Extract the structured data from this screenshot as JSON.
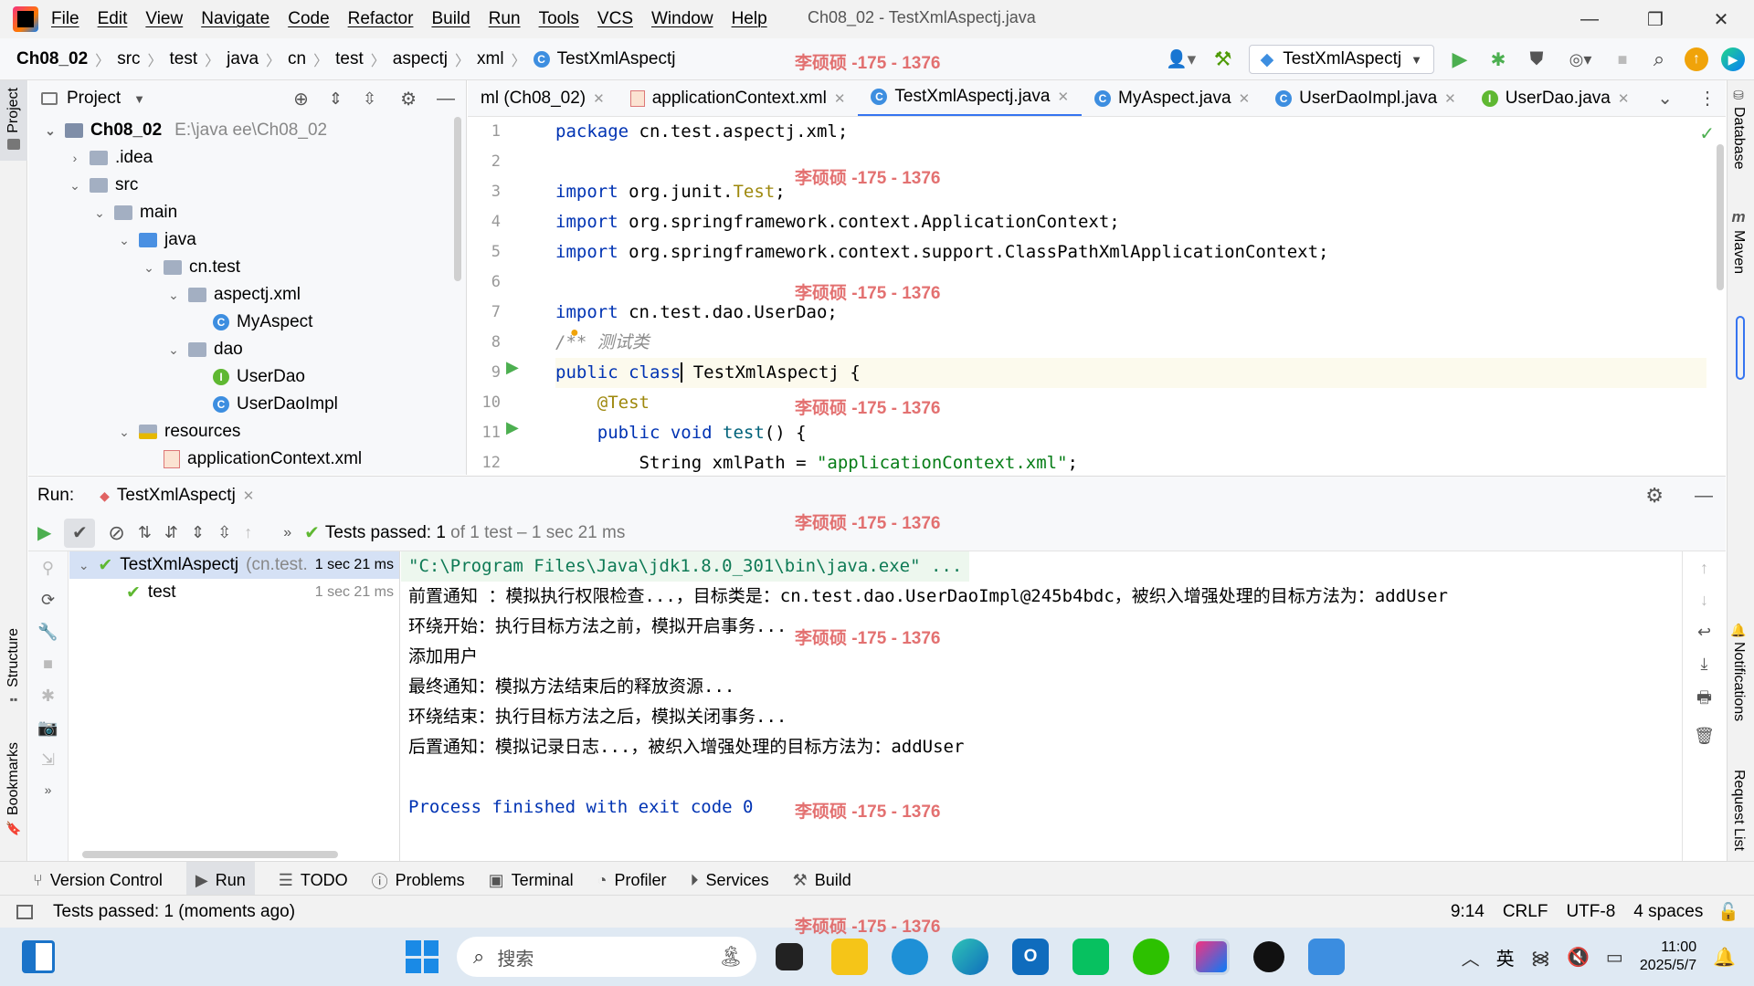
{
  "window": {
    "title": "Ch08_02 - TestXmlAspectj.java",
    "menu": [
      "File",
      "Edit",
      "View",
      "Navigate",
      "Code",
      "Refactor",
      "Build",
      "Run",
      "Tools",
      "VCS",
      "Window",
      "Help"
    ],
    "controls": [
      "—",
      "❐",
      "✕"
    ]
  },
  "breadcrumbs": [
    "Ch08_02",
    "src",
    "test",
    "java",
    "cn",
    "test",
    "aspectj",
    "xml",
    "TestXmlAspectj"
  ],
  "toolbar": {
    "run_config": "TestXmlAspectj"
  },
  "left_strip": [
    "Project",
    "Structure",
    "Bookmarks"
  ],
  "right_strip": [
    "Database",
    "Maven",
    "Notifications",
    "Request List"
  ],
  "project": {
    "header": "Project",
    "tree": [
      {
        "label": "Ch08_02",
        "hint": "E:\\java ee\\Ch08_02",
        "depth": 0,
        "kind": "module",
        "open": true
      },
      {
        "label": ".idea",
        "depth": 1,
        "kind": "folder",
        "open": false
      },
      {
        "label": "src",
        "depth": 1,
        "kind": "folder",
        "open": true
      },
      {
        "label": "main",
        "depth": 2,
        "kind": "folder",
        "open": true
      },
      {
        "label": "java",
        "depth": 3,
        "kind": "srcfolder",
        "open": true
      },
      {
        "label": "cn.test",
        "depth": 4,
        "kind": "package",
        "open": true
      },
      {
        "label": "aspectj.xml",
        "depth": 5,
        "kind": "package",
        "open": true
      },
      {
        "label": "MyAspect",
        "depth": 6,
        "kind": "class"
      },
      {
        "label": "dao",
        "depth": 5,
        "kind": "package",
        "open": true
      },
      {
        "label": "UserDao",
        "depth": 6,
        "kind": "interface"
      },
      {
        "label": "UserDaoImpl",
        "depth": 6,
        "kind": "class"
      },
      {
        "label": "resources",
        "depth": 3,
        "kind": "resfolder",
        "open": true
      },
      {
        "label": "applicationContext.xml",
        "depth": 4,
        "kind": "xml"
      }
    ]
  },
  "editor": {
    "tabs": [
      {
        "label": "ml (Ch08_02)",
        "kind": "xml",
        "active": false
      },
      {
        "label": "applicationContext.xml",
        "kind": "xml",
        "active": false
      },
      {
        "label": "TestXmlAspectj.java",
        "kind": "class",
        "active": true
      },
      {
        "label": "MyAspect.java",
        "kind": "class",
        "active": false
      },
      {
        "label": "UserDaoImpl.java",
        "kind": "class",
        "active": false
      },
      {
        "label": "UserDao.java",
        "kind": "interface",
        "active": false
      }
    ],
    "line_numbers": [
      "1",
      "2",
      "3",
      "4",
      "5",
      "6",
      "7",
      "8",
      "9",
      "10",
      "11",
      "12"
    ],
    "code": {
      "l1a": "package",
      "l1b": " cn.test.aspectj.xml;",
      "l3a": "import",
      "l3b": " org.junit.",
      "l3c": "Test",
      "l3d": ";",
      "l4a": "import",
      "l4b": " org.springframework.context.ApplicationContext;",
      "l5a": "import",
      "l5b": " org.springframework.context.support.ClassPathXmlApplicationContext;",
      "l7a": "import",
      "l7b": " cn.test.dao.UserDao;",
      "l8": "/** 测试类",
      "l9a": "public class",
      "l9b": " TestXmlAspectj",
      "l9c": " {",
      "l10": "    @Test",
      "l11a": "    public void",
      "l11b": " test",
      "l11c": "() {",
      "l12a": "        String xmlPath = ",
      "l12b": "\"applicationContext.xml\"",
      "l12c": ";"
    }
  },
  "run": {
    "label": "Run:",
    "tab": "TestXmlAspectj",
    "status_bold": "Tests passed: 1",
    "status_rest": " of 1 test – 1 sec 21 ms",
    "tree": [
      {
        "label": "TestXmlAspectj",
        "hint": "(cn.test.",
        "time": "1 sec 21 ms"
      },
      {
        "label": "test",
        "hint": "",
        "time": "1 sec 21 ms"
      }
    ],
    "console": [
      "\"C:\\Program Files\\Java\\jdk1.8.0_301\\bin\\java.exe\" ...",
      "前置通知 ：模拟执行权限检查...，目标类是：cn.test.dao.UserDaoImpl@245b4bdc，被织入增强处理的目标方法为：addUser",
      "环绕开始：执行目标方法之前，模拟开启事务...",
      "添加用户",
      "最终通知：模拟方法结束后的释放资源...",
      "环绕结束：执行目标方法之后，模拟关闭事务...",
      "后置通知：模拟记录日志...，被织入增强处理的目标方法为：addUser",
      "",
      "Process finished with exit code 0"
    ]
  },
  "bottom_tabs": [
    "Version Control",
    "Run",
    "TODO",
    "Problems",
    "Terminal",
    "Profiler",
    "Services",
    "Build"
  ],
  "status": {
    "message": "Tests passed: 1 (moments ago)",
    "position": "9:14",
    "line_sep": "CRLF",
    "encoding": "UTF-8",
    "indent": "4 spaces"
  },
  "taskbar": {
    "search_placeholder": "搜索",
    "ime": "英",
    "time": "11:00",
    "date": "2025/5/7"
  },
  "watermark": "李硕硕 -175 - 1376",
  "colors": {
    "accent": "#3574f0",
    "pass": "#5fb832",
    "keyword": "#0033b3",
    "string": "#067d17"
  }
}
